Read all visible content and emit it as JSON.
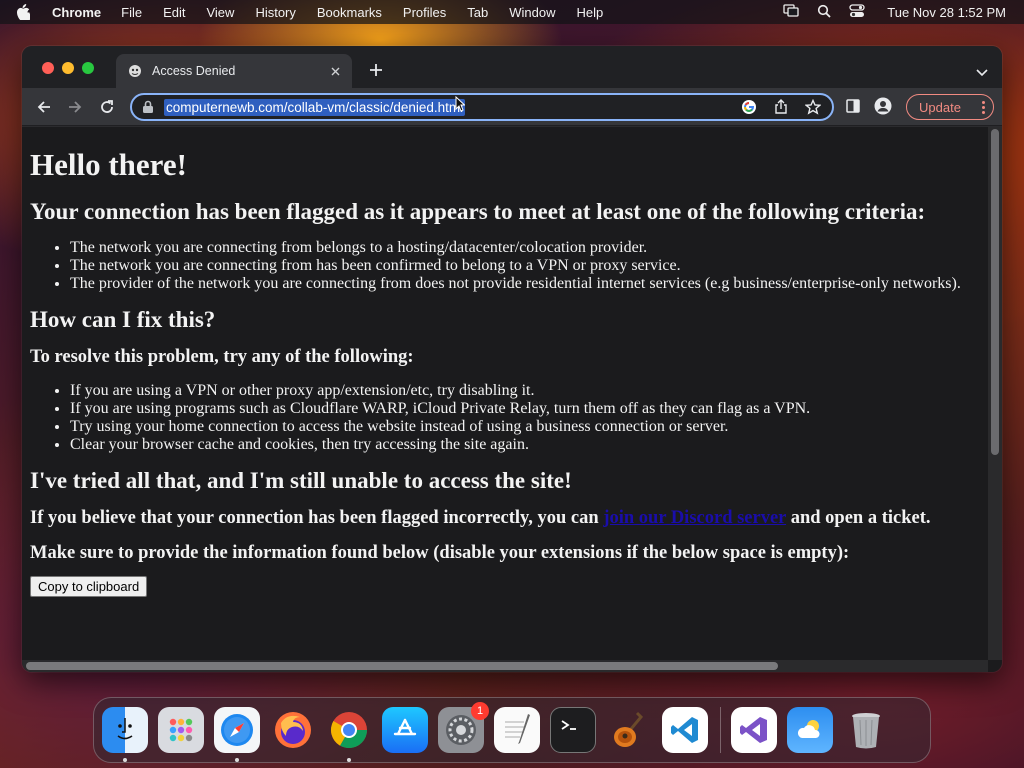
{
  "menubar": {
    "app_name": "Chrome",
    "items": [
      "File",
      "Edit",
      "View",
      "History",
      "Bookmarks",
      "Profiles",
      "Tab",
      "Window",
      "Help"
    ],
    "clock": "Tue Nov 28  1:52 PM",
    "status_icons": [
      "screen-mirroring-icon",
      "search-icon",
      "control-center-icon"
    ]
  },
  "browser": {
    "tab": {
      "title": "Access Denied",
      "favicon": "page-favicon-icon"
    },
    "url": "computernewb.com/collab-vm/classic/denied.html",
    "update_label": "Update",
    "omnibox_icons": [
      "google-lens-icon",
      "share-icon",
      "bookmark-star-icon"
    ],
    "toolbar_icons": [
      "side-panel-icon",
      "profile-icon"
    ]
  },
  "page": {
    "heading": "Hello there!",
    "criteria_heading": "Your connection has been flagged as it appears to meet at least one of the following criteria:",
    "criteria": [
      "The network you are connecting from belongs to a hosting/datacenter/colocation provider.",
      "The network you are connecting from has been confirmed to belong to a VPN or proxy service.",
      "The provider of the network you are connecting from does not provide residential internet services (e.g business/enterprise-only networks)."
    ],
    "fix_heading": "How can I fix this?",
    "resolve_heading": "To resolve this problem, try any of the following:",
    "resolve_steps": [
      "If you are using a VPN or other proxy app/extension/etc, try disabling it.",
      "If you are using programs such as Cloudflare WARP, iCloud Private Relay, turn them off as they can flag as a VPN.",
      "Try using your home connection to access the website instead of using a business connection or server.",
      "Clear your browser cache and cookies, then try accessing the site again."
    ],
    "still_heading": "I've tried all that, and I'm still unable to access the site!",
    "incorrect_prefix": "If you believe that your connection has been flagged incorrectly, you can ",
    "discord_link": "join our Discord server",
    "incorrect_suffix": " and open a ticket.",
    "info_heading": "Make sure to provide the information found below (disable your extensions if the below space is empty):",
    "copy_button": "Copy to clipboard"
  },
  "dock": {
    "apps": [
      "finder-icon",
      "launchpad-icon",
      "safari-icon",
      "firefox-icon",
      "chrome-icon",
      "app-store-icon",
      "system-settings-icon",
      "textedit-icon",
      "terminal-icon",
      "garageband-icon",
      "vscode-icon"
    ],
    "recent_apps": [
      "visual-studio-icon",
      "weather-icon",
      "trash-icon"
    ],
    "settings_badge": "1"
  }
}
